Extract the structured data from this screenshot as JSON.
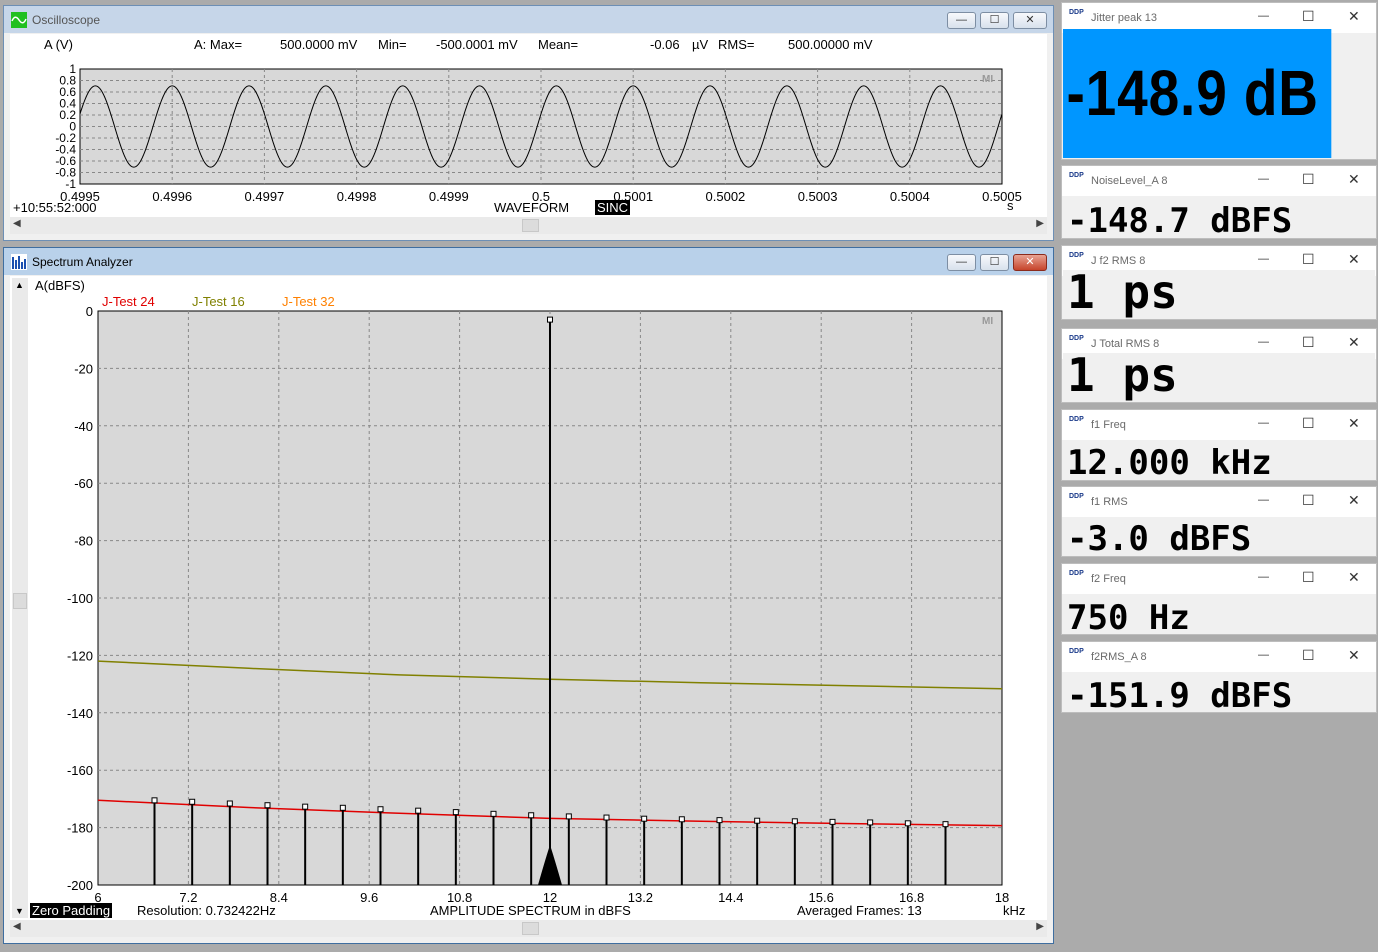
{
  "oscilloscope": {
    "title": "Oscilloscope",
    "channel_label": "A (V)",
    "stats": {
      "max_label": "A: Max=",
      "max_value": "500.0000 mV",
      "min_label": "Min=",
      "min_value": "-500.0001 mV",
      "mean_label": "Mean=",
      "mean_value": "-0.06",
      "mean_unit": "µV",
      "rms_label": "RMS=",
      "rms_value": "500.00000 mV"
    },
    "y_ticks": [
      "1",
      "0.8",
      "0.6",
      "0.4",
      "0.2",
      "0",
      "-0.2",
      "-0.4",
      "-0.6",
      "-0.8",
      "-1"
    ],
    "x_ticks": [
      "0.4995",
      "0.4996",
      "0.4997",
      "0.4998",
      "0.4999",
      "0.5",
      "0.5001",
      "0.5002",
      "0.5003",
      "0.5004",
      "0.5005"
    ],
    "x_unit": "s",
    "time_origin": "+10:55:52:000",
    "mode_label": "WAVEFORM",
    "mode_badge": "SINC",
    "corner_mark": "MI",
    "chart_data": {
      "type": "line",
      "x_range": [
        0.4995,
        0.5005
      ],
      "ylim": [
        -1,
        1
      ],
      "frequency_hz": 12000,
      "amplitude": 0.707,
      "grid": true
    }
  },
  "spectrum": {
    "title": "Spectrum Analyzer",
    "y_axis_label": "A(dBFS)",
    "legend": [
      {
        "name": "J-Test 24",
        "color": "#e00000"
      },
      {
        "name": "J-Test 16",
        "color": "#808000"
      },
      {
        "name": "J-Test 32",
        "color": "#ff8000"
      }
    ],
    "y_ticks": [
      "0",
      "-20",
      "-40",
      "-60",
      "-80",
      "-100",
      "-120",
      "-140",
      "-160",
      "-180",
      "-200"
    ],
    "x_ticks": [
      "6",
      "7.2",
      "8.4",
      "9.6",
      "10.8",
      "12",
      "13.2",
      "14.4",
      "15.6",
      "16.8",
      "18"
    ],
    "x_unit": "kHz",
    "zero_padding": "Zero Padding",
    "resolution": "Resolution: 0.732422Hz",
    "caption": "AMPLITUDE SPECTRUM in dBFS",
    "averaged": "Averaged Frames: 13",
    "corner_mark": "MI",
    "chart_data": {
      "type": "line",
      "xlim": [
        6,
        18
      ],
      "ylim": [
        -200,
        0
      ],
      "grid": true,
      "series": [
        {
          "name": "J-Test 16",
          "color": "#808000",
          "x": [
            6,
            8,
            10,
            12,
            14,
            16,
            18
          ],
          "y": [
            -122,
            -124.5,
            -126.8,
            -128.3,
            -129.5,
            -130.6,
            -131.6
          ]
        },
        {
          "name": "J-Test 24",
          "color": "#e00000",
          "x": [
            6,
            8,
            10,
            12,
            14,
            16,
            18
          ],
          "y": [
            -170.5,
            -173,
            -175,
            -176.8,
            -177.8,
            -178.6,
            -179.3
          ]
        }
      ],
      "main_tone": {
        "x": 12,
        "y": -3
      },
      "sidebands": {
        "x": [
          6.75,
          7.25,
          7.75,
          8.25,
          8.75,
          9.25,
          9.75,
          10.25,
          10.75,
          11.25,
          11.75,
          12.25,
          12.75,
          13.25,
          13.75,
          14.25,
          14.75,
          15.25,
          15.75,
          16.25,
          16.75,
          17.25
        ],
        "y": [
          -170.5,
          -171,
          -171.6,
          -172.2,
          -172.7,
          -173.1,
          -173.6,
          -174.1,
          -174.6,
          -175.2,
          -175.7,
          -176.1,
          -176.5,
          -176.9,
          -177.1,
          -177.4,
          -177.6,
          -177.8,
          -178.0,
          -178.2,
          -178.5,
          -178.8
        ]
      }
    }
  },
  "meters": [
    {
      "title": "Jitter peak  13",
      "value": "-148.9 dB"
    },
    {
      "title": "NoiseLevel_A  8",
      "value": "-148.7 dBFS"
    },
    {
      "title": "J f2 RMS  8",
      "value": "1 ps"
    },
    {
      "title": "J Total RMS  8",
      "value": "1 ps"
    },
    {
      "title": "f1 Freq",
      "value": "12.000 kHz"
    },
    {
      "title": "f1 RMS",
      "value": "-3.0 dBFS"
    },
    {
      "title": "f2 Freq",
      "value": "750 Hz"
    },
    {
      "title": "f2RMS_A  8",
      "value": "-151.9 dBFS"
    }
  ],
  "window_buttons": {
    "minimize": "—",
    "maximize": "☐",
    "close": "✕"
  },
  "meter_logo": "DDP"
}
